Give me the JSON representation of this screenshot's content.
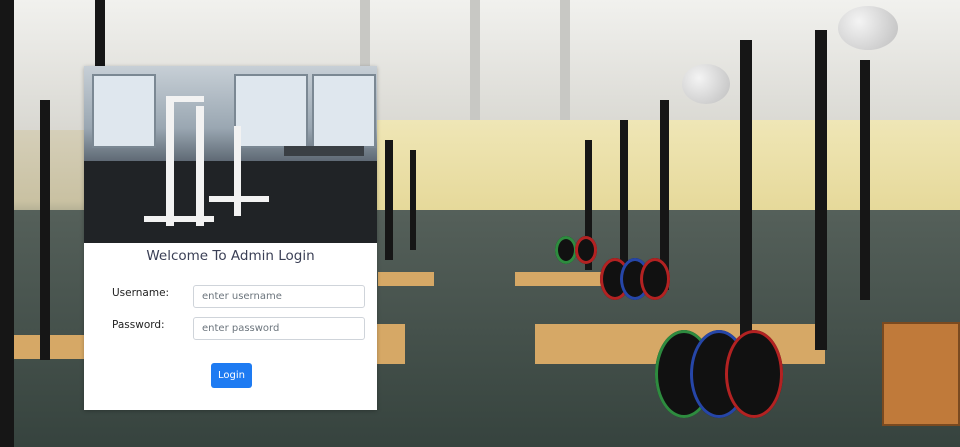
{
  "login": {
    "title": "Welcome To Admin Login",
    "username_label": "Username:",
    "username_placeholder": "enter username",
    "username_value": "",
    "password_label": "Password:",
    "password_placeholder": "enter password",
    "password_value": "",
    "submit_label": "Login"
  },
  "colors": {
    "primary": "#1e7bf2",
    "title_text": "#3a3f55"
  }
}
